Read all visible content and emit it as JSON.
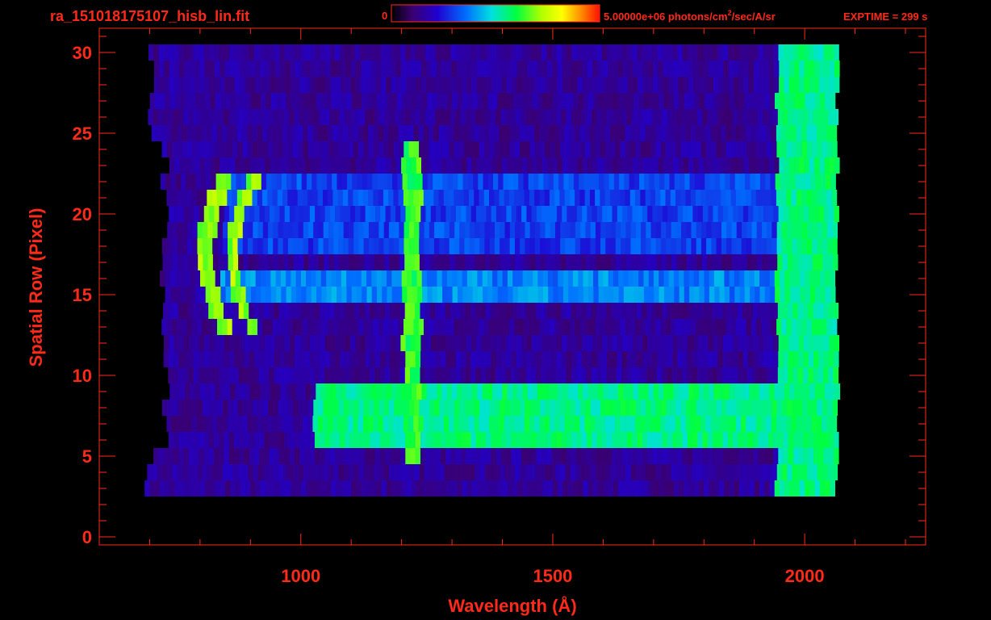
{
  "header": {
    "filename": "ra_151018175107_hisb_lin.fit",
    "colorbar_min": "0",
    "colorbar_max": "5.00000e+06 photons/cm",
    "colorbar_max_sup": "2",
    "colorbar_unit_tail": "/sec/A/sr",
    "exptime": "EXPTIME = 299 s"
  },
  "chart_data": {
    "type": "heatmap",
    "title": "ra_151018175107_hisb_lin.fit",
    "xlabel": "Wavelength (Å)",
    "ylabel": "Spatial Row (Pixel)",
    "xlim": [
      600,
      2240
    ],
    "ylim": [
      -0.5,
      31.5
    ],
    "x_ticks": [
      1000,
      1500,
      2000
    ],
    "y_ticks": [
      0,
      5,
      10,
      15,
      20,
      25,
      30
    ],
    "colorbar": {
      "min": 0,
      "max": 5000000,
      "unit": "photons/cm^2/sec/A/sr",
      "scale": "linear"
    },
    "data_extent": {
      "x": [
        700,
        2060
      ],
      "rows": [
        3,
        30
      ]
    },
    "features": [
      {
        "label": "Lyman-alpha line",
        "wavelength": 1216,
        "rows": [
          5,
          24
        ],
        "level": 0.62
      },
      {
        "label": "arc feature",
        "wavelength_range": [
          800,
          900
        ],
        "rows": [
          13,
          22
        ],
        "level": 0.7
      },
      {
        "label": "continuum band",
        "wavelength_range": [
          1020,
          2020
        ],
        "rows": [
          6,
          9
        ],
        "level": 0.55
      },
      {
        "label": "continuum band",
        "wavelength_range": [
          840,
          2020
        ],
        "rows": [
          15,
          16
        ],
        "level": 0.38
      },
      {
        "label": "continuum band",
        "wavelength_range": [
          840,
          2020
        ],
        "rows": [
          18,
          22
        ],
        "level": 0.3
      },
      {
        "label": "red edge",
        "wavelength_range": [
          1940,
          2060
        ],
        "rows": [
          0,
          30
        ],
        "level": 0.55
      }
    ]
  },
  "colors": {
    "text": "#ff2a1a",
    "axes": "#ff2a1a",
    "background": "#000000"
  }
}
